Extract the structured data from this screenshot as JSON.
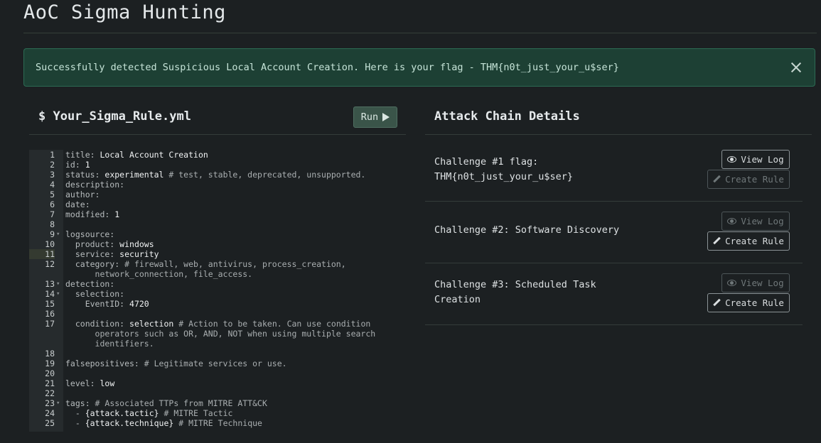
{
  "header": {
    "title": "AoC Sigma Hunting"
  },
  "alert": {
    "message": "Successfully detected Suspicious Local Account Creation. Here is your flag - THM{n0t_just_your_u$ser}",
    "close_icon": "close-icon"
  },
  "editor": {
    "filename": "$ Your_Sigma_Rule.yml",
    "run_label": "Run",
    "run_icon": "play-icon",
    "lines": [
      {
        "n": "1",
        "parts": [
          [
            "key",
            "title: "
          ],
          [
            "val",
            "Local Account Creation"
          ]
        ]
      },
      {
        "n": "2",
        "parts": [
          [
            "key",
            "id: "
          ],
          [
            "val",
            "1"
          ]
        ]
      },
      {
        "n": "3",
        "parts": [
          [
            "key",
            "status: "
          ],
          [
            "val",
            "experimental "
          ],
          [
            "cmt",
            "# test, stable, deprecated, unsupported."
          ]
        ]
      },
      {
        "n": "4",
        "parts": [
          [
            "key",
            "description:"
          ]
        ]
      },
      {
        "n": "5",
        "parts": [
          [
            "key",
            "author:"
          ]
        ]
      },
      {
        "n": "6",
        "parts": [
          [
            "key",
            "date:"
          ]
        ]
      },
      {
        "n": "7",
        "parts": [
          [
            "key",
            "modified: "
          ],
          [
            "val",
            "1"
          ]
        ]
      },
      {
        "n": "8",
        "parts": []
      },
      {
        "n": "9",
        "fold": true,
        "parts": [
          [
            "key",
            "logsource:"
          ]
        ]
      },
      {
        "n": "10",
        "parts": [
          [
            "key",
            "  product: "
          ],
          [
            "val",
            "windows"
          ]
        ]
      },
      {
        "n": "11",
        "active": true,
        "parts": [
          [
            "key",
            "  service: "
          ],
          [
            "val",
            "security"
          ]
        ]
      },
      {
        "n": "12",
        "parts": [
          [
            "key",
            "  category: "
          ],
          [
            "cmt",
            "# firewall, web, antivirus, process_creation,"
          ]
        ]
      },
      {
        "n": "",
        "parts": [
          [
            "cmt",
            "      network_connection, file_access."
          ]
        ]
      },
      {
        "n": "13",
        "fold": true,
        "parts": [
          [
            "key",
            "detection:"
          ]
        ]
      },
      {
        "n": "14",
        "fold": true,
        "parts": [
          [
            "key",
            "  selection:"
          ]
        ]
      },
      {
        "n": "15",
        "parts": [
          [
            "key",
            "    EventID: "
          ],
          [
            "val",
            "4720"
          ]
        ]
      },
      {
        "n": "16",
        "parts": []
      },
      {
        "n": "17",
        "parts": [
          [
            "key",
            "  condition: "
          ],
          [
            "val",
            "selection "
          ],
          [
            "cmt",
            "# Action to be taken. Can use condition"
          ]
        ]
      },
      {
        "n": "",
        "parts": [
          [
            "cmt",
            "      operators such as OR, AND, NOT when using multiple search"
          ]
        ]
      },
      {
        "n": "",
        "parts": [
          [
            "cmt",
            "      identifiers."
          ]
        ]
      },
      {
        "n": "18",
        "parts": []
      },
      {
        "n": "19",
        "parts": [
          [
            "key",
            "falsepositives: "
          ],
          [
            "cmt",
            "# Legitimate services or use."
          ]
        ]
      },
      {
        "n": "20",
        "parts": []
      },
      {
        "n": "21",
        "parts": [
          [
            "key",
            "level: "
          ],
          [
            "val",
            "low"
          ]
        ]
      },
      {
        "n": "22",
        "parts": []
      },
      {
        "n": "23",
        "fold": true,
        "parts": [
          [
            "key",
            "tags: "
          ],
          [
            "cmt",
            "# Associated TTPs from MITRE ATT&CK"
          ]
        ]
      },
      {
        "n": "24",
        "parts": [
          [
            "key",
            "  - "
          ],
          [
            "val",
            "{attack.tactic} "
          ],
          [
            "cmt",
            "# MITRE Tactic"
          ]
        ]
      },
      {
        "n": "25",
        "parts": [
          [
            "key",
            "  - "
          ],
          [
            "val",
            "{attack.technique} "
          ],
          [
            "cmt",
            "# MITRE Technique"
          ]
        ]
      }
    ]
  },
  "attack_chain": {
    "heading": "Attack Chain Details",
    "challenges": [
      {
        "line1": "Challenge #1 flag:",
        "line2": "THM{n0t_just_your_u$ser}",
        "view_log": "View Log",
        "view_enabled": true,
        "create_rule": "Create Rule",
        "create_enabled": false
      },
      {
        "line1": "Challenge #2: Software Discovery",
        "line2": "",
        "view_log": "View Log",
        "view_enabled": false,
        "create_rule": "Create Rule",
        "create_enabled": true
      },
      {
        "line1": "Challenge #3: Scheduled Task",
        "line2": "Creation",
        "view_log": "View Log",
        "view_enabled": false,
        "create_rule": "Create Rule",
        "create_enabled": true
      }
    ]
  }
}
